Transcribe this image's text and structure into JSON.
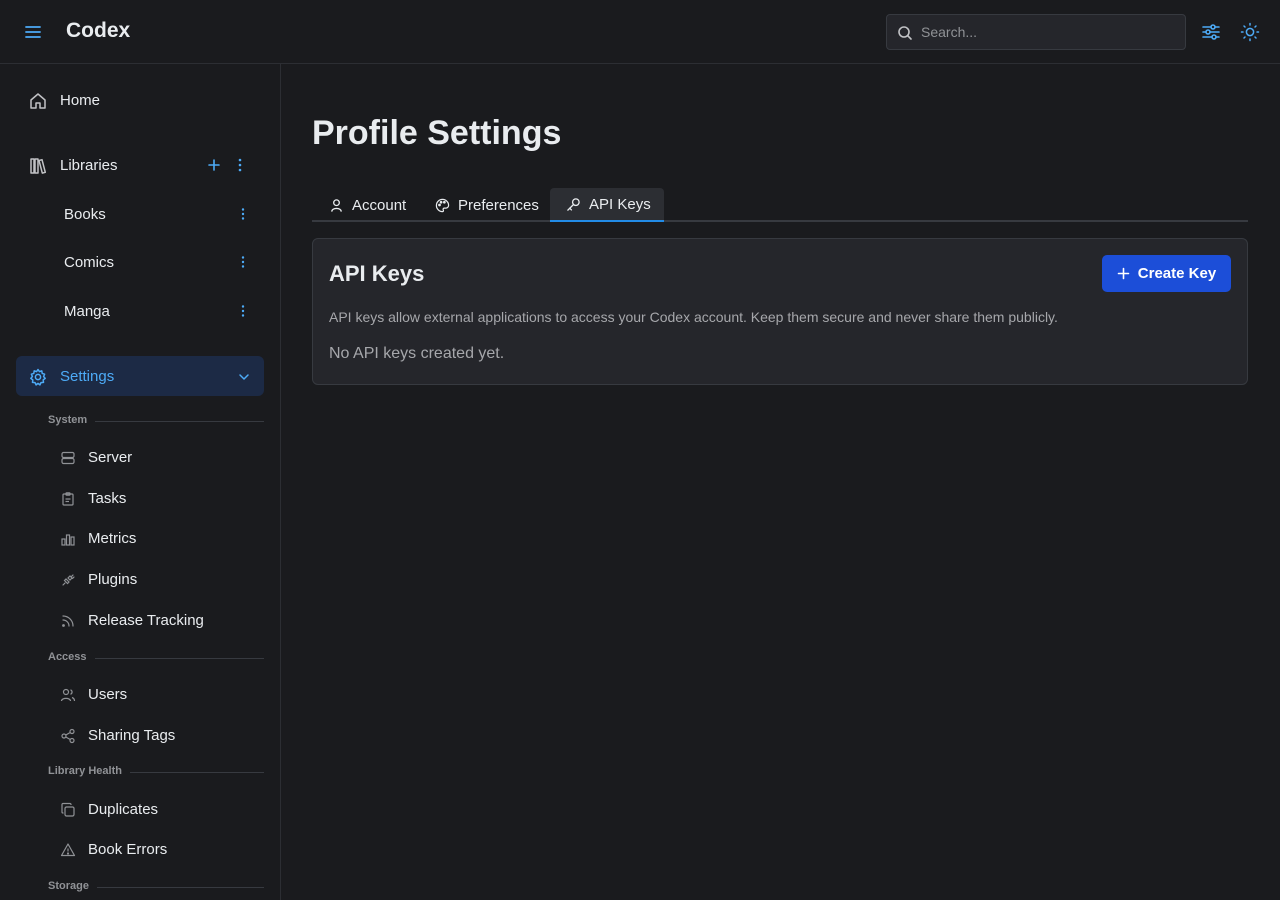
{
  "header": {
    "app_title": "Codex",
    "search_placeholder": "Search..."
  },
  "sidebar": {
    "home_label": "Home",
    "libraries_label": "Libraries",
    "libraries": [
      {
        "label": "Books"
      },
      {
        "label": "Comics"
      },
      {
        "label": "Manga"
      }
    ],
    "settings_label": "Settings",
    "sections": {
      "system": "System",
      "access": "Access",
      "library_health": "Library Health",
      "storage": "Storage"
    },
    "system_items": [
      {
        "label": "Server",
        "icon": "server-icon"
      },
      {
        "label": "Tasks",
        "icon": "clipboard-icon"
      },
      {
        "label": "Metrics",
        "icon": "bar-chart-icon"
      },
      {
        "label": "Plugins",
        "icon": "plug-icon"
      },
      {
        "label": "Release Tracking",
        "icon": "rss-icon"
      }
    ],
    "access_items": [
      {
        "label": "Users",
        "icon": "users-icon"
      },
      {
        "label": "Sharing Tags",
        "icon": "share-icon"
      }
    ],
    "health_items": [
      {
        "label": "Duplicates",
        "icon": "copy-icon"
      },
      {
        "label": "Book Errors",
        "icon": "warning-icon"
      }
    ]
  },
  "main": {
    "page_title": "Profile Settings",
    "tabs": [
      {
        "label": "Account",
        "icon": "user-icon"
      },
      {
        "label": "Preferences",
        "icon": "palette-icon"
      },
      {
        "label": "API Keys",
        "icon": "key-icon",
        "active": true
      }
    ],
    "card": {
      "title": "API Keys",
      "create_label": "Create Key",
      "description": "API keys allow external applications to access your Codex account. Keep them secure and never share them publicly.",
      "empty_text": "No API keys created yet."
    }
  },
  "colors": {
    "background": "#1a1b1e",
    "card": "#25262b",
    "accent": "#4dabf7",
    "primary_button": "#1c4ed8",
    "active_tab_underline": "#228be6"
  }
}
